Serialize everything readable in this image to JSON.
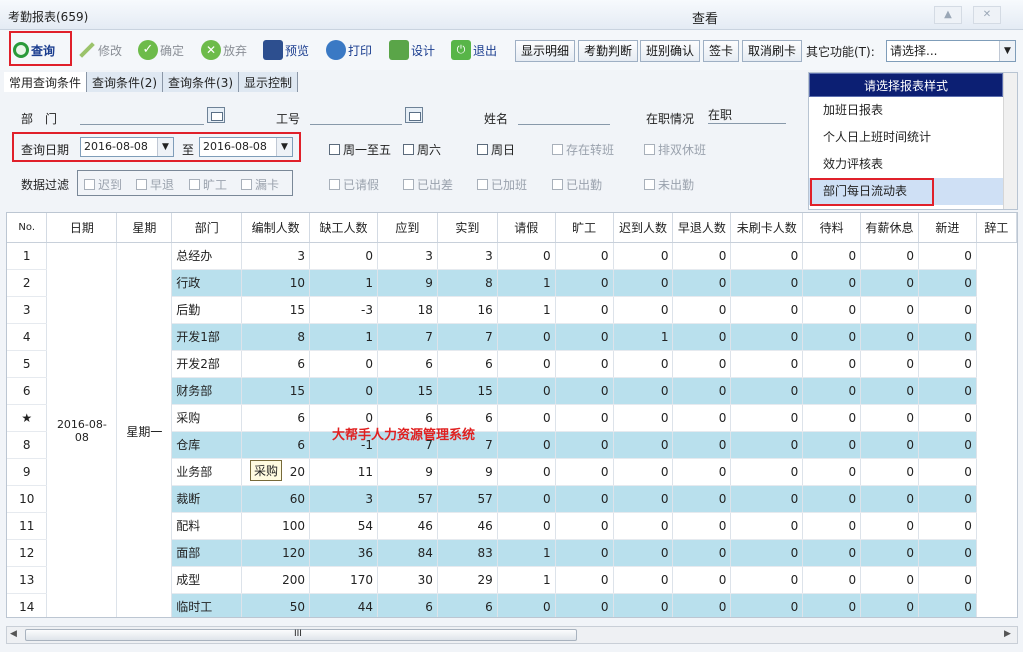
{
  "window": {
    "title": "考勤报表(659)",
    "center_title": "查看"
  },
  "toolbar": {
    "query": "查询",
    "edit": "修改",
    "confirm": "确定",
    "discard": "放弃",
    "preview": "预览",
    "print": "打印",
    "design": "设计",
    "exit": "退出",
    "show_detail": "显示明细",
    "attendance_judge": "考勤判断",
    "shift_confirm": "班别确认",
    "sign_card": "签卡",
    "cancel_swipe": "取消刷卡",
    "other_label": "其它功能(T):",
    "other_value": "请选择..."
  },
  "tabs": [
    "常用查询条件",
    "查询条件(2)",
    "查询条件(3)",
    "显示控制"
  ],
  "filters": {
    "dept": "部　门",
    "emp_no": "工号",
    "name": "姓名",
    "status_label": "在职情况",
    "status_value": "在职",
    "date_label": "查询日期",
    "date_from": "2016-08-08",
    "to": "至",
    "date_to": "2016-08-08",
    "mon_fri": "周一至五",
    "sat": "周六",
    "sun": "周日",
    "transfer": "存在转班",
    "double_rest": "排双休班",
    "data_filter": "数据过滤",
    "late": "迟到",
    "early": "早退",
    "absent": "旷工",
    "miss": "漏卡",
    "leave_req": "已请假",
    "biz": "已出差",
    "ot": "已加班",
    "out": "已出勤",
    "not_out": "未出勤"
  },
  "report_panel": {
    "header": "请选择报表样式",
    "items": [
      "加班日报表",
      "个人日上班时间统计",
      "效力评核表",
      "部门每日流动表"
    ]
  },
  "grid": {
    "columns": [
      "No.",
      "日期",
      "星期",
      "部门",
      "编制人数",
      "缺工人数",
      "应到",
      "实到",
      "请假",
      "旷工",
      "迟到人数",
      "早退人数",
      "未刷卡人数",
      "待料",
      "有薪休息",
      "新进",
      "辞工"
    ],
    "date": "2016-08-08",
    "weekday": "星期一",
    "rows": [
      [
        "1",
        "总经办",
        "3",
        "0",
        "3",
        "3",
        "0",
        "0",
        "0",
        "0",
        "0",
        "0",
        "0",
        "0"
      ],
      [
        "2",
        "行政",
        "10",
        "1",
        "9",
        "8",
        "1",
        "0",
        "0",
        "0",
        "0",
        "0",
        "0",
        "0"
      ],
      [
        "3",
        "后勤",
        "15",
        "-3",
        "18",
        "16",
        "1",
        "0",
        "0",
        "0",
        "0",
        "0",
        "0",
        "0"
      ],
      [
        "4",
        "开发1部",
        "8",
        "1",
        "7",
        "7",
        "0",
        "0",
        "1",
        "0",
        "0",
        "0",
        "0",
        "0"
      ],
      [
        "5",
        "开发2部",
        "6",
        "0",
        "6",
        "6",
        "0",
        "0",
        "0",
        "0",
        "0",
        "0",
        "0",
        "0"
      ],
      [
        "6",
        "财务部",
        "15",
        "0",
        "15",
        "15",
        "0",
        "0",
        "0",
        "0",
        "0",
        "0",
        "0",
        "0"
      ],
      [
        "★",
        "采购",
        "6",
        "0",
        "6",
        "6",
        "0",
        "0",
        "0",
        "0",
        "0",
        "0",
        "0",
        "0"
      ],
      [
        "8",
        "仓库",
        "6",
        "-1",
        "7",
        "7",
        "0",
        "0",
        "0",
        "0",
        "0",
        "0",
        "0",
        "0"
      ],
      [
        "9",
        "业务部",
        "20",
        "11",
        "9",
        "9",
        "0",
        "0",
        "0",
        "0",
        "0",
        "0",
        "0",
        "0"
      ],
      [
        "10",
        "裁断",
        "60",
        "3",
        "57",
        "57",
        "0",
        "0",
        "0",
        "0",
        "0",
        "0",
        "0",
        "0"
      ],
      [
        "11",
        "配料",
        "100",
        "54",
        "46",
        "46",
        "0",
        "0",
        "0",
        "0",
        "0",
        "0",
        "0",
        "0"
      ],
      [
        "12",
        "面部",
        "120",
        "36",
        "84",
        "83",
        "1",
        "0",
        "0",
        "0",
        "0",
        "0",
        "0",
        "0"
      ],
      [
        "13",
        "成型",
        "200",
        "170",
        "30",
        "29",
        "1",
        "0",
        "0",
        "0",
        "0",
        "0",
        "0",
        "0"
      ],
      [
        "14",
        "临时工",
        "50",
        "44",
        "6",
        "6",
        "0",
        "0",
        "0",
        "0",
        "0",
        "0",
        "0",
        "0"
      ]
    ]
  },
  "tooltip": "采购",
  "watermark": "大帮手人力资源管理系统",
  "scroll_grip": "III"
}
